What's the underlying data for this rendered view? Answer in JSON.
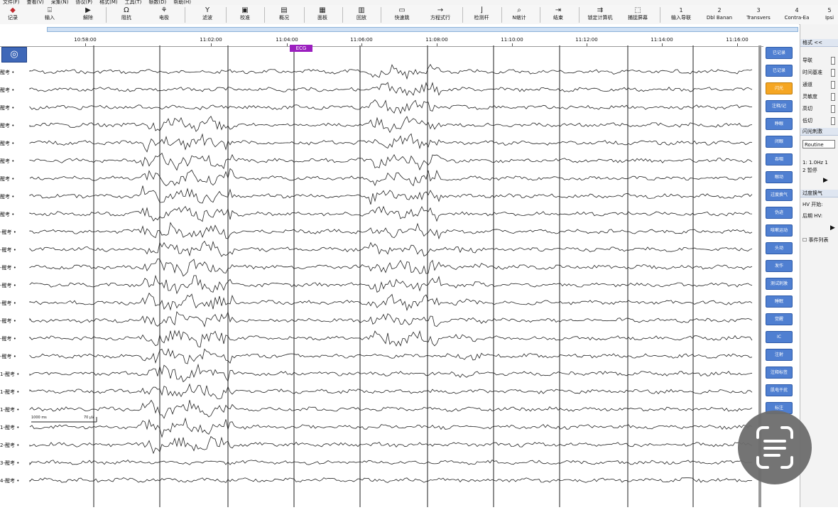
{
  "menu": [
    "文件(F)",
    "查看(V)",
    "采集(N)",
    "协议(P)",
    "格式(M)",
    "工具(T)",
    "帧数(D)",
    "帮助(H)"
  ],
  "toolbar": [
    {
      "icon": "record-icon",
      "label": "记录"
    },
    {
      "icon": "input-icon",
      "label": "输入"
    },
    {
      "icon": "play-icon",
      "label": "解除"
    },
    {
      "icon": "impedance-icon",
      "label": "阻抗"
    },
    {
      "icon": "electrode-icon",
      "label": "电极"
    },
    {
      "icon": "filter-icon",
      "label": "滤波"
    },
    {
      "icon": "calibrate-icon",
      "label": "校准"
    },
    {
      "icon": "review-icon",
      "label": "概况"
    },
    {
      "icon": "panel-icon",
      "label": "面板"
    },
    {
      "icon": "playback-icon",
      "label": "回放"
    },
    {
      "icon": "fast-icon",
      "label": "快速跳"
    },
    {
      "icon": "arrow-icon",
      "label": "方程式行"
    },
    {
      "icon": "marker-icon",
      "label": "检测杆"
    },
    {
      "icon": "zoom-icon",
      "label": "N缩计"
    },
    {
      "icon": "end-icon",
      "label": "结束"
    },
    {
      "icon": "lock-icon",
      "label": "锁定计算机"
    },
    {
      "icon": "capture-icon",
      "label": "捕捉屏幕"
    },
    {
      "icon": "num1",
      "label": "输入导联",
      "num": "1"
    },
    {
      "icon": "num2",
      "label": "Dbl Banan",
      "num": "2"
    },
    {
      "icon": "num3",
      "label": "Transvers",
      "num": "3"
    },
    {
      "icon": "num4",
      "label": "Contra-Ea",
      "num": "4"
    },
    {
      "icon": "num5",
      "label": "Ipsi",
      "num": "5"
    }
  ],
  "time_ticks": [
    "10:58:00",
    "11:02:00",
    "11:04:00",
    "11:06:00",
    "11:08:00",
    "11:10:00",
    "11:12:00",
    "11:14:00",
    "11:16:00"
  ],
  "event_marker": "ECG",
  "channels": [
    "醒考 •",
    "醒考 •",
    "醒考 •",
    "醒考 •",
    "醒考 •",
    "醒考 •",
    "醒考 •",
    "醒考 •",
    "醒考 •",
    "-醒考 •",
    "-醒考 •",
    "-醒考 •",
    "-醒考 •",
    "-醒考 •",
    "-醒考 •",
    "-醒考 •",
    "-醒考 •",
    "1-醒考 •",
    "1-醒考 •",
    "1-醒考 •",
    "1-醒考 •",
    "2-醒考 •",
    "3-醒考 •",
    "4-醒考 •"
  ],
  "scale": {
    "time": "1000 ms",
    "amp": "70 µV"
  },
  "event_buttons": [
    {
      "label": "已记录",
      "active": false
    },
    {
      "label": "已记录",
      "active": false
    },
    {
      "label": "闪光",
      "active": true
    },
    {
      "label": "注释/记",
      "active": false
    },
    {
      "label": "睁眼",
      "active": false
    },
    {
      "label": "闭眼",
      "active": false
    },
    {
      "label": "吞咽",
      "active": false
    },
    {
      "label": "眼动",
      "active": false
    },
    {
      "label": "过度换气",
      "active": false
    },
    {
      "label": "伪迹",
      "active": false
    },
    {
      "label": "咳嗽运动",
      "active": false
    },
    {
      "label": "头动",
      "active": false
    },
    {
      "label": "发作",
      "active": false
    },
    {
      "label": "测试刺激",
      "active": false
    },
    {
      "label": "睡眠",
      "active": false
    },
    {
      "label": "觉醒",
      "active": false
    },
    {
      "label": "IC",
      "active": false
    },
    {
      "label": "注射",
      "active": false
    },
    {
      "label": "注释标签",
      "active": false
    },
    {
      "label": "肌电干扰",
      "active": false
    },
    {
      "label": "标注",
      "active": false
    }
  ],
  "right_panel": {
    "format_title": "格式 <<",
    "format_rows": [
      "导联",
      "时间基准",
      "通道",
      "灵敏度",
      "高切",
      "低切"
    ],
    "stim_title": "闪光刺激",
    "stim_value": "Routine",
    "stim_rows": [
      "1: 1.0Hz  1",
      "2        暂停"
    ],
    "hv_title": "过度换气",
    "hv_rows": [
      "HV 开始:",
      "后期 HV:"
    ],
    "event_list": "事件列表"
  },
  "colors": {
    "accent": "#4f7fd1",
    "active": "#f5a623",
    "marker": "#9b1fbf",
    "trace": "#222222"
  }
}
